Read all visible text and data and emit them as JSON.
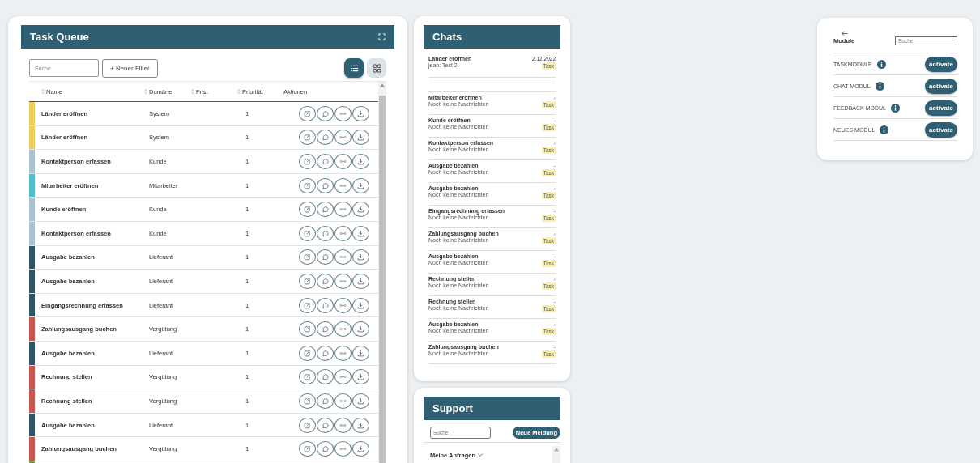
{
  "task_queue": {
    "title": "Task Queue",
    "search": {
      "placeholder": "Suche"
    },
    "filter_button": "+ Neuer Filter",
    "view_toggle": [
      {
        "kind": "list",
        "selected": true
      },
      {
        "kind": "grid",
        "selected": false
      }
    ],
    "columns": [
      {
        "label": "Name",
        "sortable": true
      },
      {
        "label": "Domäne",
        "sortable": true
      },
      {
        "label": "Frist",
        "sortable": true
      },
      {
        "label": "Priorität",
        "sortable": true
      },
      {
        "label": "Aktionen",
        "sortable": false
      }
    ],
    "rows": [
      {
        "name": "Länder eröffnen",
        "domain": "System",
        "priority": "1",
        "color": "#f0cc5c"
      },
      {
        "name": "Länder eröffnen",
        "domain": "System",
        "priority": "1",
        "color": "#f0cc5c"
      },
      {
        "name": "Kontaktperson erfassen",
        "domain": "Kunde",
        "priority": "1",
        "color": "#a9c3d1"
      },
      {
        "name": "Mitarbeiter eröffnen",
        "domain": "Mitarbeiter",
        "priority": "1",
        "color": "#4fbfd0"
      },
      {
        "name": "Kunde eröffnen",
        "domain": "Kunde",
        "priority": "1",
        "color": "#a9c3d1"
      },
      {
        "name": "Kontaktperson erfassen",
        "domain": "Kunde",
        "priority": "1",
        "color": "#a9c3d1"
      },
      {
        "name": "Ausgabe bezahlen",
        "domain": "Lieferant",
        "priority": "1",
        "color": "#2e5467"
      },
      {
        "name": "Ausgabe bezahlen",
        "domain": "Lieferant",
        "priority": "1",
        "color": "#2e5467"
      },
      {
        "name": "Eingangsrechnung erfassen",
        "domain": "Lieferant",
        "priority": "1",
        "color": "#2e5467"
      },
      {
        "name": "Zahlungsausgang buchen",
        "domain": "Vergütung",
        "priority": "1",
        "color": "#c9574f"
      },
      {
        "name": "Ausgabe bezahlen",
        "domain": "Lieferant",
        "priority": "1",
        "color": "#2e5467"
      },
      {
        "name": "Rechnung stellen",
        "domain": "Vergütung",
        "priority": "1",
        "color": "#c9574f"
      },
      {
        "name": "Rechnung stellen",
        "domain": "Vergütung",
        "priority": "1",
        "color": "#c9574f"
      },
      {
        "name": "Ausgabe bezahlen",
        "domain": "Lieferant",
        "priority": "1",
        "color": "#2e5467"
      },
      {
        "name": "Zahlungsausgang buchen",
        "domain": "Vergütung",
        "priority": "1",
        "color": "#c9574f"
      },
      {
        "color": "#5cae4a"
      }
    ]
  },
  "chats": {
    "title": "Chats",
    "items": [
      {
        "title": "Länder eröffnen",
        "message": "jean: Test 2",
        "date": "2.12.2022",
        "tag": "Task"
      },
      {
        "kind": "spacer"
      },
      {
        "title": "Mitarbeiter eröffnen",
        "message": "Noch keine Nachrichten",
        "date": "-",
        "tag": "Task"
      },
      {
        "title": "Kunde eröffnen",
        "message": "Noch keine Nachrichten",
        "date": "-",
        "tag": "Task"
      },
      {
        "title": "Kontaktperson erfassen",
        "message": "Noch keine Nachrichten",
        "date": "-",
        "tag": "Task"
      },
      {
        "title": "Ausgabe bezahlen",
        "message": "Noch keine Nachrichten",
        "date": "-",
        "tag": "Task"
      },
      {
        "title": "Ausgabe bezahlen",
        "message": "Noch keine Nachrichten",
        "date": "-",
        "tag": "Task"
      },
      {
        "title": "Eingangsrechnung erfassen",
        "message": "Noch keine Nachrichten",
        "date": "-",
        "tag": "Task"
      },
      {
        "title": "Zahlungsausgang buchen",
        "message": "Noch keine Nachrichten",
        "date": "-",
        "tag": "Task"
      },
      {
        "title": "Ausgabe bezahlen",
        "message": "Noch keine Nachrichten",
        "date": "-",
        "tag": "Task"
      },
      {
        "title": "Rechnung stellen",
        "message": "Noch keine Nachrichten",
        "date": "-",
        "tag": "Task"
      },
      {
        "title": "Rechnung stellen",
        "message": "Noch keine Nachrichten",
        "date": "-",
        "tag": "Task"
      },
      {
        "title": "Ausgabe bezahlen",
        "message": "Noch keine Nachrichten",
        "date": "-",
        "tag": "Task"
      },
      {
        "title": "Zahlungsausgang buchen",
        "message": "Noch keine Nachrichten",
        "date": "-",
        "tag": "Task"
      }
    ]
  },
  "support": {
    "title": "Support",
    "search": {
      "placeholder": "Suche"
    },
    "new_button": "Neue Meldung",
    "section": "Meine Anfragen",
    "expanded": false
  },
  "modules": {
    "title": "Module",
    "search": {
      "placeholder": "Suche"
    },
    "items": [
      {
        "name": "TASKMODULE",
        "button": "activate"
      },
      {
        "name": "CHAT MODUL",
        "button": "activate"
      },
      {
        "name": "FEEDBACK MODUL",
        "button": "activate"
      },
      {
        "name": "NEUES MODUL",
        "button": "activate"
      }
    ]
  }
}
